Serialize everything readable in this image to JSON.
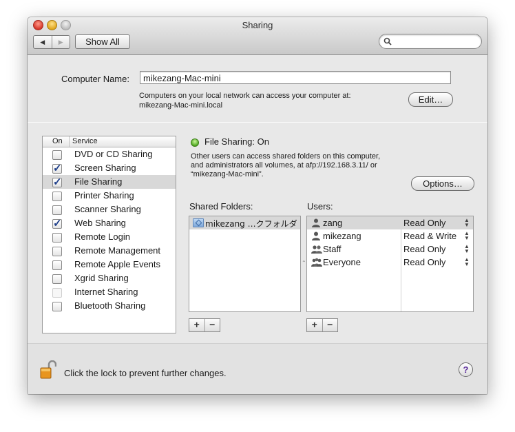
{
  "window": {
    "title": "Sharing"
  },
  "toolbar": {
    "back_glyph": "◀",
    "forward_glyph": "▶",
    "show_all_label": "Show All",
    "search_placeholder": ""
  },
  "computer": {
    "label": "Computer Name:",
    "value": "mikezang-Mac-mini",
    "note_line1": "Computers on your local network can access your computer at:",
    "note_line2": "mikezang-Mac-mini.local",
    "edit_label": "Edit…"
  },
  "services": {
    "header_on": "On",
    "header_service": "Service",
    "items": [
      {
        "label": "DVD or CD Sharing",
        "checked": false,
        "dim": false
      },
      {
        "label": "Screen Sharing",
        "checked": true,
        "dim": false
      },
      {
        "label": "File Sharing",
        "checked": true,
        "dim": false
      },
      {
        "label": "Printer Sharing",
        "checked": false,
        "dim": false
      },
      {
        "label": "Scanner Sharing",
        "checked": false,
        "dim": false
      },
      {
        "label": "Web Sharing",
        "checked": true,
        "dim": false
      },
      {
        "label": "Remote Login",
        "checked": false,
        "dim": false
      },
      {
        "label": "Remote Management",
        "checked": false,
        "dim": false
      },
      {
        "label": "Remote Apple Events",
        "checked": false,
        "dim": false
      },
      {
        "label": "Xgrid Sharing",
        "checked": false,
        "dim": false
      },
      {
        "label": "Internet Sharing",
        "checked": false,
        "dim": true
      },
      {
        "label": "Bluetooth Sharing",
        "checked": false,
        "dim": false
      }
    ],
    "selected_index": 2
  },
  "status": {
    "title": "File Sharing: On",
    "desc_line1": "Other users can access shared folders on this computer,",
    "desc_line2": "and administrators all volumes, at afp://192.168.3.11/ or",
    "desc_line3": "“mikezang-Mac-mini”.",
    "status_color": "#4aa51a"
  },
  "options_label": "Options…",
  "shared_folders": {
    "label": "Shared Folders:",
    "items": [
      {
        "name": "mikezang …クフォルダ",
        "icon": "shared-folder-icon"
      }
    ]
  },
  "users": {
    "label": "Users:",
    "items": [
      {
        "name": "zang",
        "permission": "Read Only",
        "icon": "user-icon"
      },
      {
        "name": "mikezang",
        "permission": "Read & Write",
        "icon": "user-icon"
      },
      {
        "name": "Staff",
        "permission": "Read Only",
        "icon": "group-icon"
      },
      {
        "name": "Everyone",
        "permission": "Read Only",
        "icon": "everyone-icon"
      }
    ]
  },
  "buttons": {
    "plus": "+",
    "minus": "−"
  },
  "footer": {
    "lock_text": "Click the lock to prevent further changes.",
    "help": "?"
  },
  "colors": {
    "selection": "#d8d8d8",
    "check": "#1f3f8a",
    "help": "#5a2a9a"
  }
}
